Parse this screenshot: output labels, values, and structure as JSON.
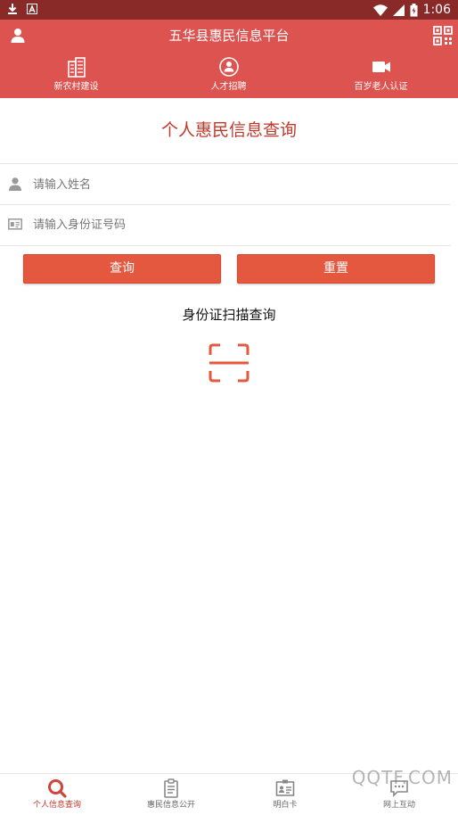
{
  "status_bar": {
    "time": "1:06"
  },
  "header": {
    "title": "五华县惠民信息平台",
    "nav": [
      {
        "label": "新农村建设",
        "icon": "building-icon"
      },
      {
        "label": "人才招聘",
        "icon": "talent-icon"
      },
      {
        "label": "百岁老人认证",
        "icon": "video-camera-icon"
      }
    ]
  },
  "form": {
    "title": "个人惠民信息查询",
    "name_placeholder": "请输入姓名",
    "id_placeholder": "请输入身份证号码",
    "query_label": "查询",
    "reset_label": "重置",
    "scan_title": "身份证扫描查询"
  },
  "tabs": [
    {
      "label": "个人信息查询",
      "icon": "search-icon",
      "active": true
    },
    {
      "label": "惠民信息公开",
      "icon": "clipboard-icon",
      "active": false
    },
    {
      "label": "明白卡",
      "icon": "id-card-icon",
      "active": false
    },
    {
      "label": "网上互动",
      "icon": "chat-icon",
      "active": false
    }
  ],
  "watermark": "QQTF.COM",
  "colors": {
    "header": "#dc5350",
    "status_bar": "#8a2a28",
    "accent": "#e4583f",
    "title": "#c0392b"
  }
}
